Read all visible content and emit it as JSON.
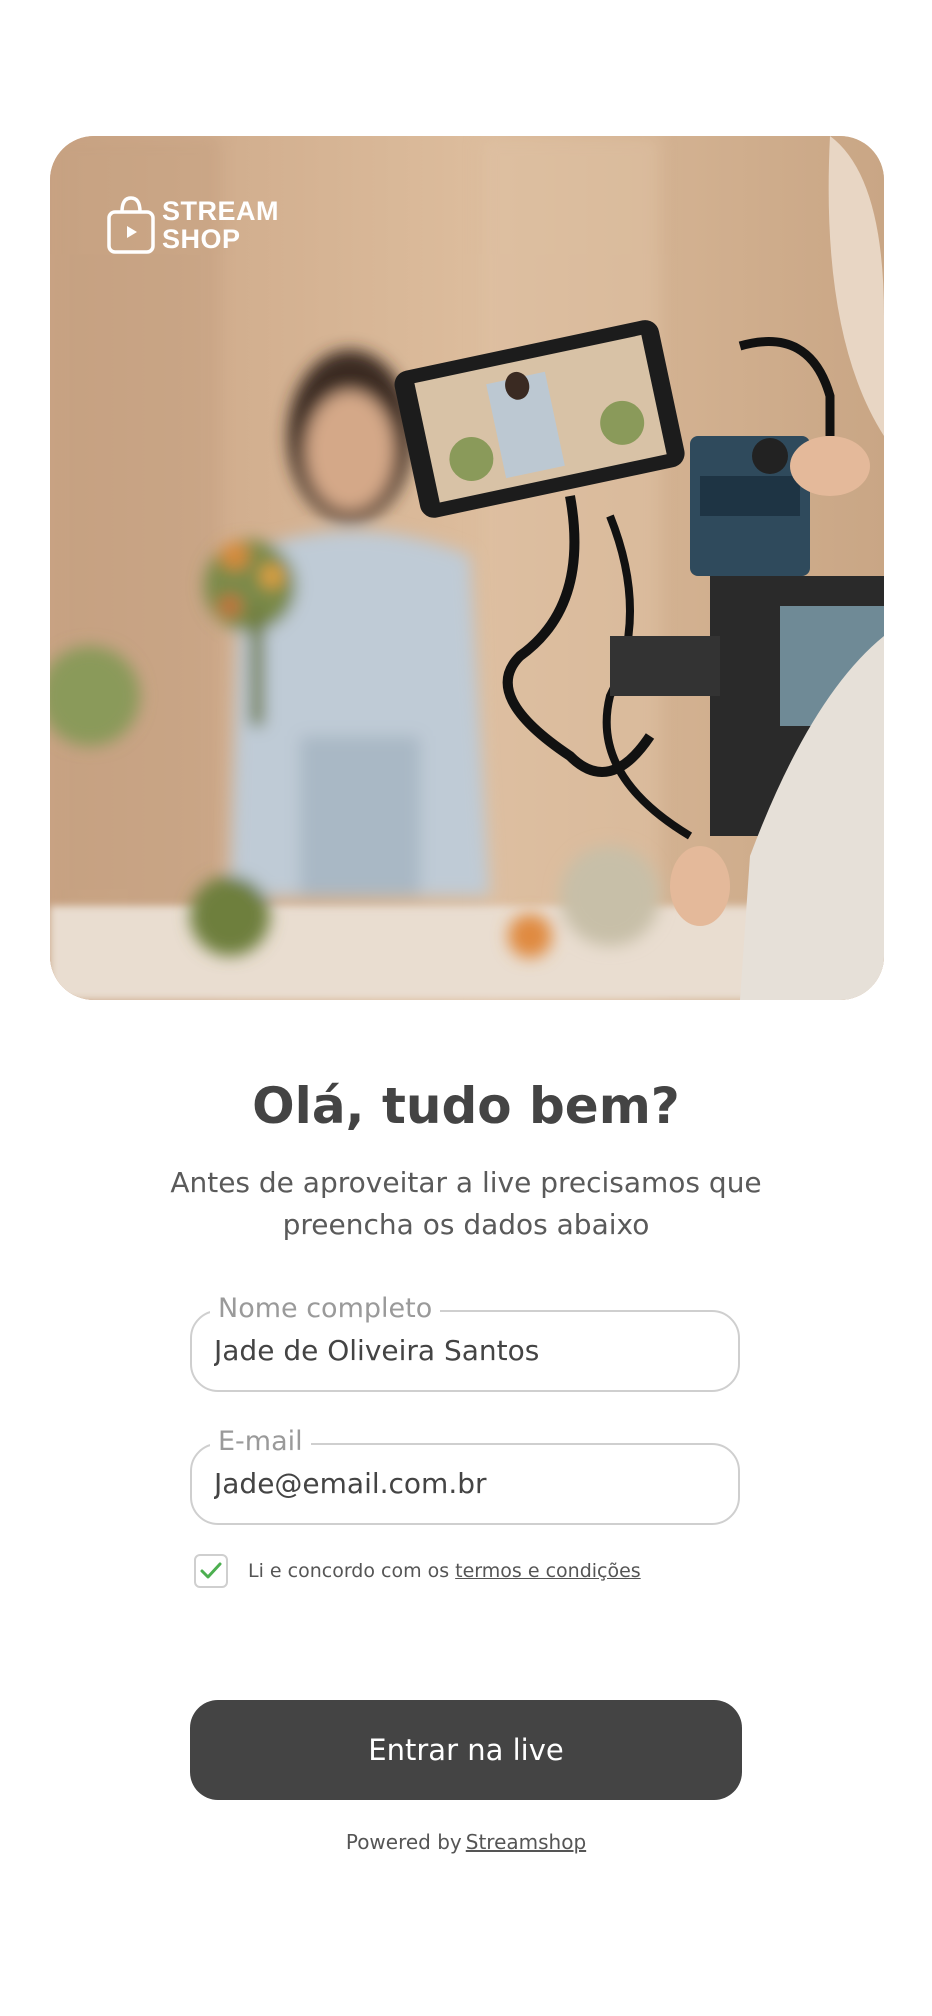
{
  "brand": {
    "logo_line1": "STREAM",
    "logo_line2": "SHOP"
  },
  "heading": {
    "title": "Olá, tudo bem?",
    "subtitle": "Antes de aproveitar a live precisamos que preencha os dados abaixo"
  },
  "form": {
    "name_label": "Nome completo",
    "name_value": "Jade de Oliveira Santos",
    "email_label": "E-mail",
    "email_value": "Jade@email.com.br",
    "terms_checked": true,
    "terms_text": "Li e concordo com os",
    "terms_link": "termos e condições",
    "submit_label": "Entrar na live"
  },
  "footer": {
    "powered_text": "Powered by",
    "powered_link": "Streamshop"
  },
  "colors": {
    "primary_button": "#444444",
    "check_green": "#4caf50",
    "border": "#cfcfcf"
  },
  "icons": {
    "logo": "shopping-bag-play-icon",
    "checkbox": "check-icon"
  }
}
